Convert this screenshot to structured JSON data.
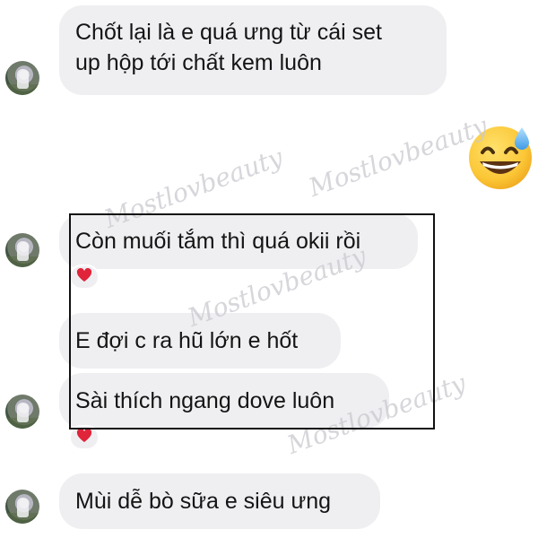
{
  "messages": [
    {
      "text_line1": "Chốt lại là e quá ưng từ cái set",
      "text_line2": "up hộp tới chất kem luôn"
    },
    {
      "text": "Còn muối tắm thì quá okii rồi",
      "reaction": "heart"
    },
    {
      "text": "E đợi c ra hũ lớn e hốt"
    },
    {
      "text": "Sài thích ngang dove luôn",
      "reaction": "heart"
    },
    {
      "text": "Mùi dễ bò sữa e siêu ưng"
    }
  ],
  "outgoing_emoji": "grinning-face-with-sweat",
  "watermark": "Mostlovbeauty",
  "colors": {
    "bubble": "#efeff2",
    "text": "#141414",
    "heart": "#e0243a",
    "watermark": "#c9c9cf",
    "emoji_face": "#fbc737"
  }
}
